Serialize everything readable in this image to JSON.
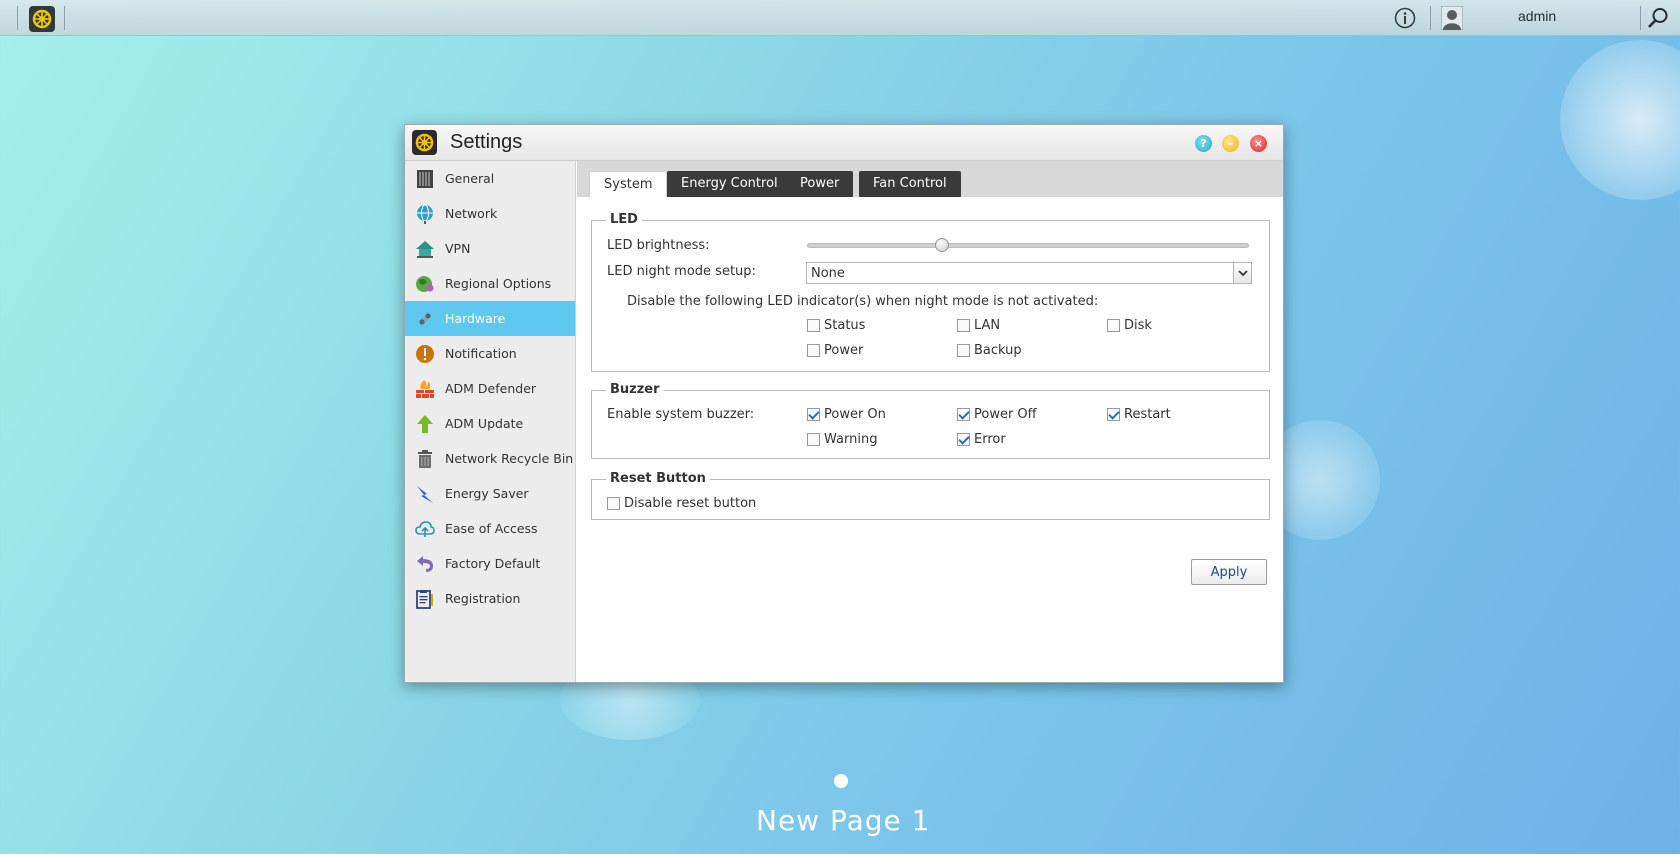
{
  "topbar": {
    "username": "admin"
  },
  "window": {
    "title": "Settings"
  },
  "sidebar": {
    "items": [
      {
        "label": "General",
        "icon": "nas-icon"
      },
      {
        "label": "Network",
        "icon": "globe-icon"
      },
      {
        "label": "VPN",
        "icon": "vpn-house-icon"
      },
      {
        "label": "Regional Options",
        "icon": "globe-pin-icon"
      },
      {
        "label": "Hardware",
        "icon": "hardware-icon",
        "active": true
      },
      {
        "label": "Notification",
        "icon": "alert-icon"
      },
      {
        "label": "ADM Defender",
        "icon": "firewall-icon"
      },
      {
        "label": "ADM Update",
        "icon": "arrow-up-icon"
      },
      {
        "label": "Network Recycle Bin",
        "icon": "trash-icon"
      },
      {
        "label": "Energy Saver",
        "icon": "lightning-icon"
      },
      {
        "label": "Ease of Access",
        "icon": "cloud-icon"
      },
      {
        "label": "Factory Default",
        "icon": "undo-icon"
      },
      {
        "label": "Registration",
        "icon": "clipboard-icon"
      }
    ]
  },
  "tabs": [
    {
      "label": "System",
      "active": true
    },
    {
      "label": "Energy Control"
    },
    {
      "label": "Power"
    },
    {
      "label": "Fan Control"
    }
  ],
  "led": {
    "legend": "LED",
    "brightness_label": "LED brightness:",
    "brightness_level": 0.3,
    "night_mode_label": "LED night mode setup:",
    "night_mode_value": "None",
    "disable_text": "Disable the following LED indicator(s) when night mode is not activated:",
    "indicators": [
      {
        "label": "Status",
        "checked": false
      },
      {
        "label": "LAN",
        "checked": false
      },
      {
        "label": "Disk",
        "checked": false
      },
      {
        "label": "Power",
        "checked": false
      },
      {
        "label": "Backup",
        "checked": false
      }
    ]
  },
  "buzzer": {
    "legend": "Buzzer",
    "enable_label": "Enable system buzzer:",
    "options": [
      {
        "label": "Power On",
        "checked": true
      },
      {
        "label": "Power Off",
        "checked": true
      },
      {
        "label": "Restart",
        "checked": true
      },
      {
        "label": "Warning",
        "checked": false
      },
      {
        "label": "Error",
        "checked": true
      }
    ]
  },
  "reset": {
    "legend": "Reset Button",
    "disable_label": "Disable reset button",
    "checked": false
  },
  "apply_label": "Apply",
  "desktop": {
    "page_label": "New Page 1"
  }
}
